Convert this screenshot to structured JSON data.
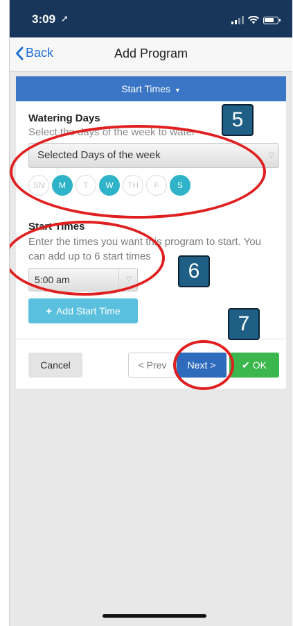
{
  "status_bar": {
    "time": "3:09"
  },
  "nav": {
    "back_label": "Back",
    "title": "Add Program"
  },
  "section": {
    "title": "Start Times"
  },
  "watering_days": {
    "title": "Watering Days",
    "helper": "Select the days of the week to water",
    "select_value": "Selected Days of the week",
    "days": [
      {
        "label": "SN",
        "selected": false
      },
      {
        "label": "M",
        "selected": true
      },
      {
        "label": "T",
        "selected": false
      },
      {
        "label": "W",
        "selected": true
      },
      {
        "label": "TH",
        "selected": false
      },
      {
        "label": "F",
        "selected": false
      },
      {
        "label": "S",
        "selected": true
      }
    ]
  },
  "start_times": {
    "title": "Start Times",
    "helper": "Enter the times you want this program to start. You can add up to 6 start times",
    "time_value": "5:00 am",
    "add_label": "Add Start Time"
  },
  "footer": {
    "cancel": "Cancel",
    "prev": "< Prev",
    "next": "Next >",
    "ok": "OK"
  },
  "annotations": {
    "badge_5": "5",
    "badge_6": "6",
    "badge_7": "7"
  },
  "colors": {
    "accent_blue": "#3b76c6",
    "day_selected": "#2fb3c8",
    "ok_green": "#3bb74d",
    "annotation_red": "#e02020"
  }
}
